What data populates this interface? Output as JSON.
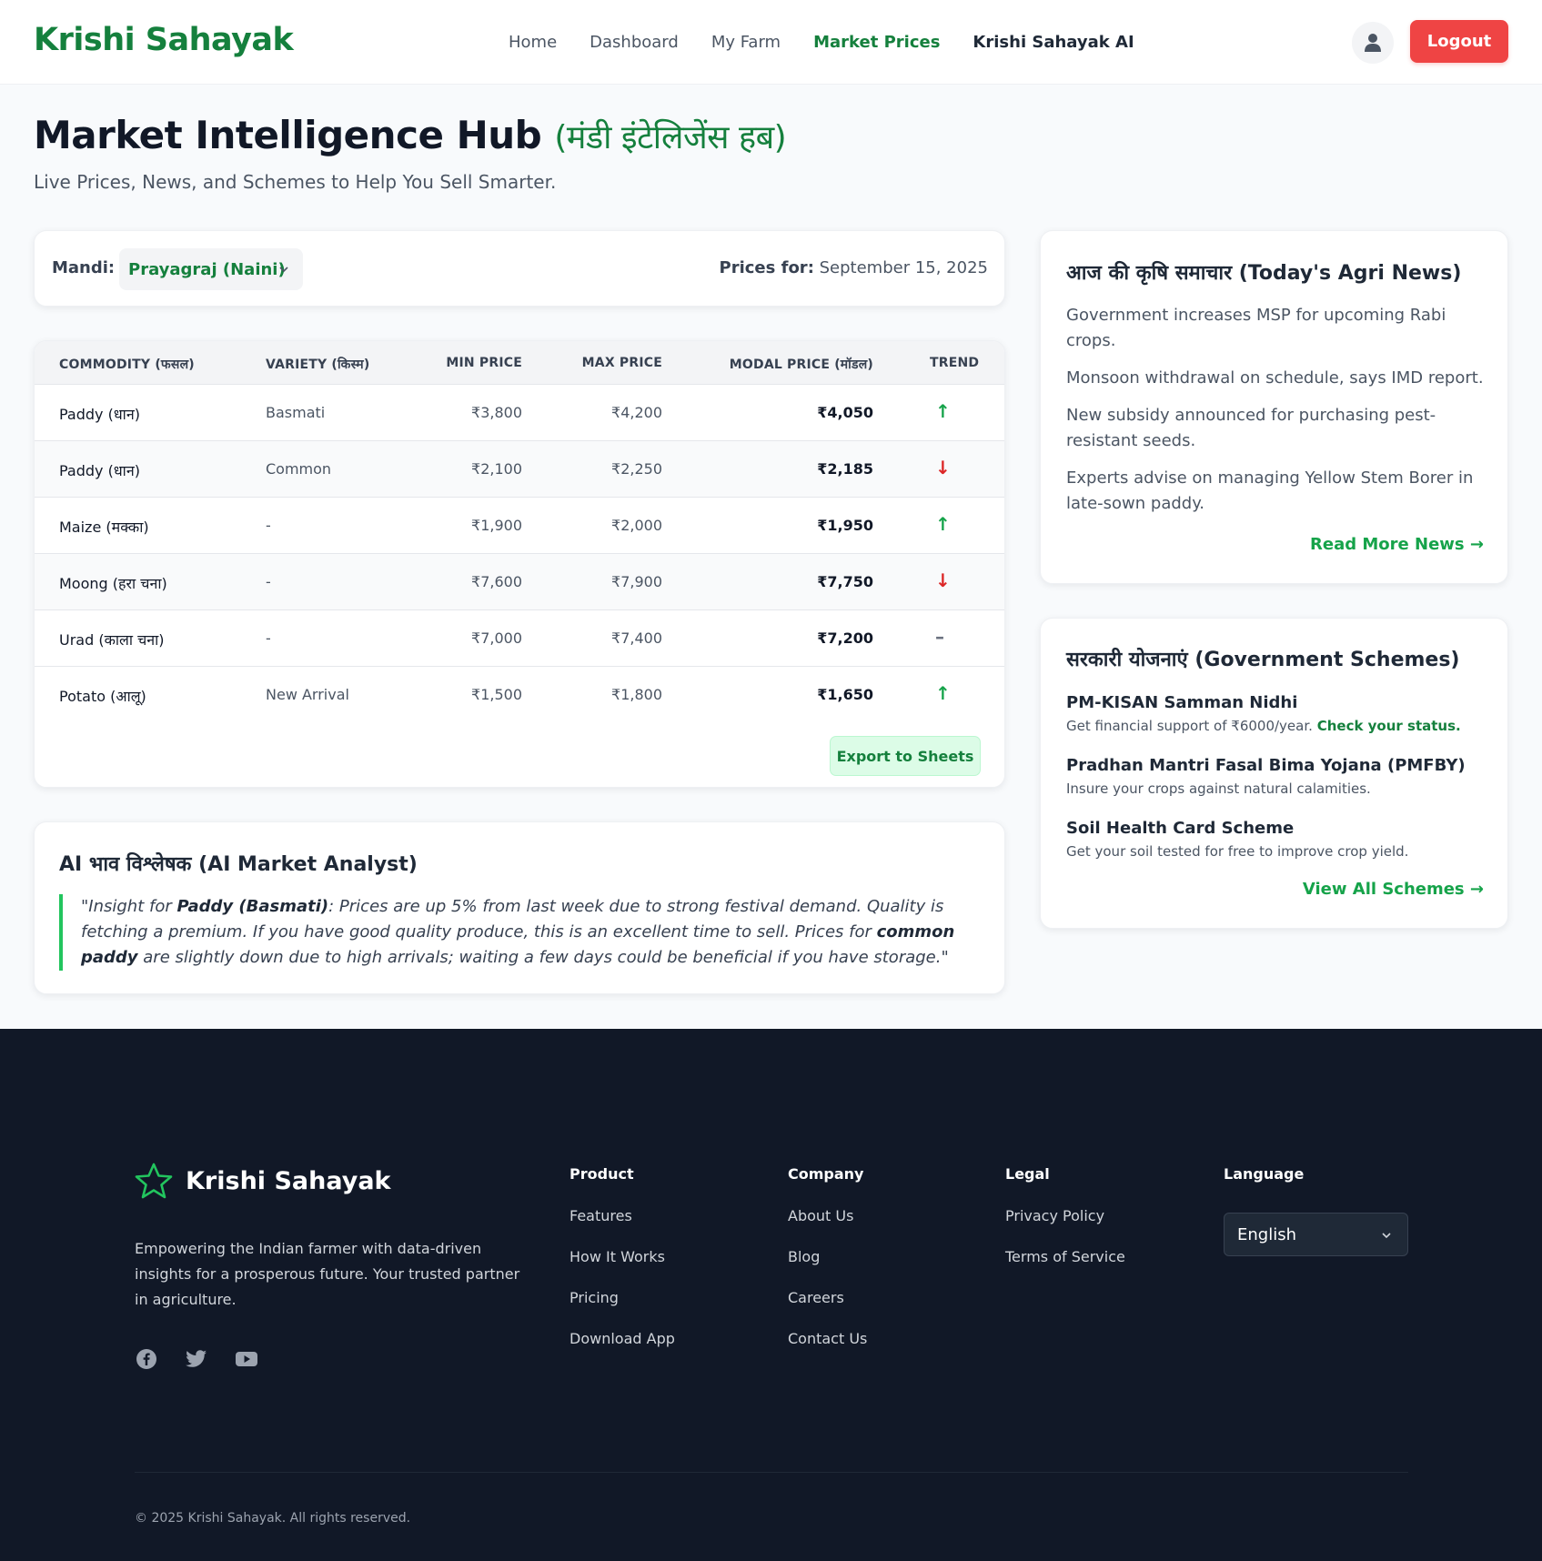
{
  "nav": {
    "brand": "Krishi Sahayak",
    "links": [
      "Home",
      "Dashboard",
      "My Farm",
      "Market Prices",
      "Krishi Sahayak AI"
    ],
    "active": "Market Prices",
    "logout_label": "Logout"
  },
  "header": {
    "title": "Market Intelligence Hub",
    "title_hindi": "(मंडी इंटेलिजेंस हब)",
    "subtitle": "Live Prices, News, and Schemes to Help You Sell Smarter."
  },
  "mandi": {
    "label": "Mandi:",
    "selected": "Prayagraj (Naini)",
    "prices_for_label": "Prices for:",
    "date": "September 15, 2025"
  },
  "table": {
    "columns": [
      "COMMODITY (फसल)",
      "VARIETY (किस्म)",
      "MIN PRICE",
      "MAX PRICE",
      "MODAL PRICE (मॉडल)",
      "TREND"
    ],
    "rows": [
      {
        "commodity": "Paddy (धान)",
        "variety": "Basmati",
        "min": "₹3,800",
        "max": "₹4,200",
        "modal": "₹4,050",
        "trend": "up",
        "trend_symbol": "↑"
      },
      {
        "commodity": "Paddy (धान)",
        "variety": "Common",
        "min": "₹2,100",
        "max": "₹2,250",
        "modal": "₹2,185",
        "trend": "down",
        "trend_symbol": "↓"
      },
      {
        "commodity": "Maize (मक्का)",
        "variety": "-",
        "min": "₹1,900",
        "max": "₹2,000",
        "modal": "₹1,950",
        "trend": "up",
        "trend_symbol": "↑"
      },
      {
        "commodity": "Moong (हरा चना)",
        "variety": "-",
        "min": "₹7,600",
        "max": "₹7,900",
        "modal": "₹7,750",
        "trend": "down",
        "trend_symbol": "↓"
      },
      {
        "commodity": "Urad (काला चना)",
        "variety": "-",
        "min": "₹7,000",
        "max": "₹7,400",
        "modal": "₹7,200",
        "trend": "flat",
        "trend_symbol": "–"
      },
      {
        "commodity": "Potato (आलू)",
        "variety": "New Arrival",
        "min": "₹1,500",
        "max": "₹1,800",
        "modal": "₹1,650",
        "trend": "up",
        "trend_symbol": "↑"
      }
    ],
    "export_label": "Export to Sheets"
  },
  "ai": {
    "title": "AI भाव विश्लेषक (AI Market Analyst)",
    "quote_open": "\"Insight for ",
    "quote_bold1": "Paddy (Basmati)",
    "quote_mid": ": Prices are up 5% from last week due to strong festival demand. Quality is fetching a premium. If you have good quality produce, this is an excellent time to sell. Prices for ",
    "quote_bold2": "common paddy",
    "quote_end": " are slightly down due to high arrivals; waiting a few days could be beneficial if you have storage.\""
  },
  "news": {
    "title": "आज की कृषि समाचार (Today's Agri News)",
    "items": [
      "Government increases MSP for upcoming Rabi crops.",
      "Monsoon withdrawal on schedule, says IMD report.",
      "New subsidy announced for purchasing pest-resistant seeds.",
      "Experts advise on managing Yellow Stem Borer in late-sown paddy."
    ],
    "link": "Read More News →"
  },
  "schemes": {
    "title": "सरकारी योजनाएं (Government Schemes)",
    "items": [
      {
        "name": "PM-KISAN Samman Nidhi",
        "desc": "Get financial support of ₹6000/year.",
        "link": "Check your status."
      },
      {
        "name": "Pradhan Mantri Fasal Bima Yojana (PMFBY)",
        "desc": "Insure your crops against natural calamities."
      },
      {
        "name": "Soil Health Card Scheme",
        "desc": "Get your soil tested for free to improve crop yield."
      }
    ],
    "link": "View All Schemes →"
  },
  "footer": {
    "brand": "Krishi Sahayak",
    "description": "Empowering the Indian farmer with data-driven insights for a prosperous future. Your trusted partner in agriculture.",
    "socials": [
      "facebook-icon",
      "twitter-icon",
      "youtube-icon"
    ],
    "columns": [
      {
        "title": "Product",
        "items": [
          "Features",
          "How It Works",
          "Pricing",
          "Download App"
        ]
      },
      {
        "title": "Company",
        "items": [
          "About Us",
          "Blog",
          "Careers",
          "Contact Us"
        ]
      },
      {
        "title": "Legal",
        "items": [
          "Privacy Policy",
          "Terms of Service"
        ]
      }
    ],
    "language_title": "Language",
    "language_selected": "English",
    "copyright": "© 2025 Krishi Sahayak. All rights reserved."
  },
  "colors": {
    "brand_green": "#15803d",
    "logout_red": "#ef4444",
    "footer_bg": "#111827"
  }
}
